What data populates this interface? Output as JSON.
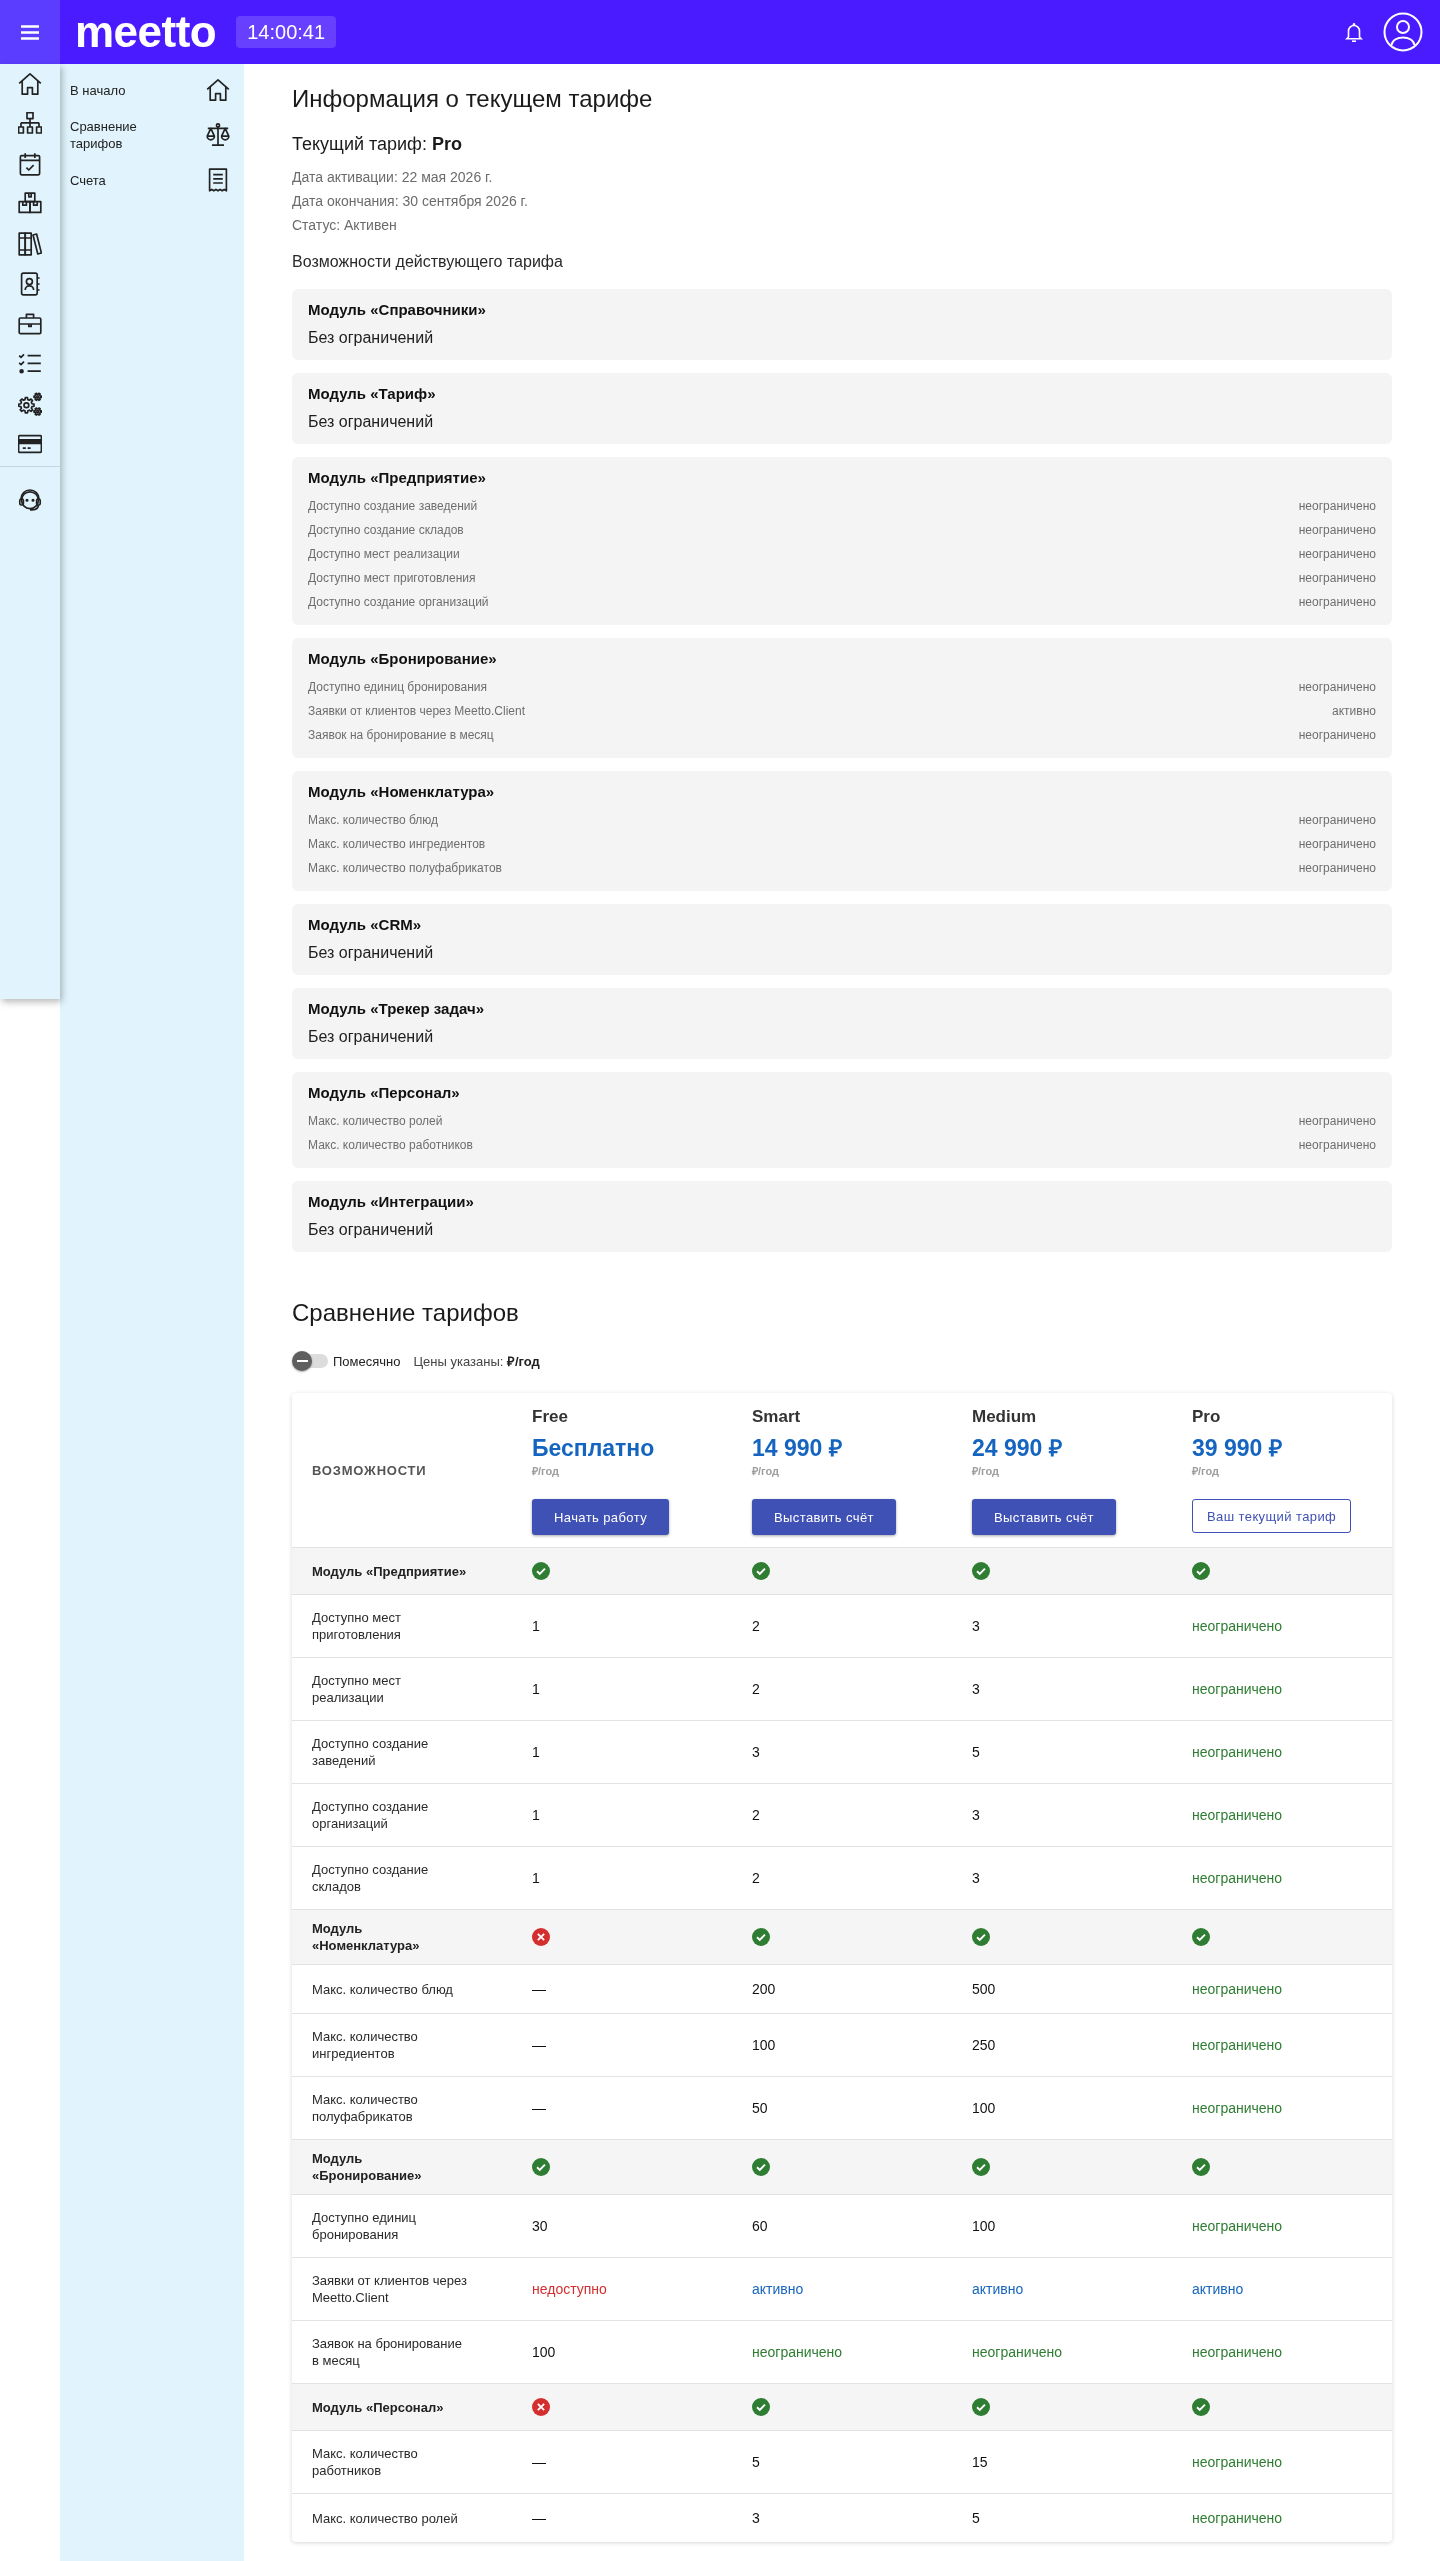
{
  "header": {
    "logo": "meetto",
    "clock": "14:00:41"
  },
  "sidebar": {
    "items": [
      "В начало",
      "Сравнение тарифов",
      "Счета"
    ]
  },
  "tariff_info": {
    "title": "Информация о текущем тарифе",
    "current": "Текущий тариф: **Pro**",
    "details": [
      "Дата активации: 22 мая 2026 г.",
      "Дата окончания: 30 сентября 2026 г.",
      "Статус: Активен"
    ],
    "features_title": "Возможности действующего тарифа",
    "modules": [
      {
        "kind": "summary",
        "title": "Модуль «Справочники»",
        "summary": "Без ограничений"
      },
      {
        "kind": "summary",
        "title": "Модуль «Тариф»",
        "summary": "Без ограничений"
      },
      {
        "kind": "limits",
        "title": "Модуль «Предприятие»",
        "limits": [
          {
            "label": "Доступно создание заведений",
            "value": "неограничено"
          },
          {
            "label": "Доступно создание складов",
            "value": "неограничено"
          },
          {
            "label": "Доступно мест реализации",
            "value": "неограничено"
          },
          {
            "label": "Доступно мест приготовления",
            "value": "неограничено"
          },
          {
            "label": "Доступно создание организаций",
            "value": "неограничено"
          }
        ]
      },
      {
        "kind": "limits",
        "title": "Модуль «Бронирование»",
        "limits": [
          {
            "label": "Доступно единиц бронирования",
            "value": "неограничено"
          },
          {
            "label": "Заявки от клиентов через Meetto.Client",
            "value": "активно"
          },
          {
            "label": "Заявок на бронирование в месяц",
            "value": "неограничено"
          }
        ]
      },
      {
        "kind": "limits",
        "title": "Модуль «Номенклатура»",
        "limits": [
          {
            "label": "Макс. количество блюд",
            "value": "неограничено"
          },
          {
            "label": "Макс. количество ингредиентов",
            "value": "неограничено"
          },
          {
            "label": "Макс. количество полуфабрикатов",
            "value": "неограничено"
          }
        ]
      },
      {
        "kind": "summary",
        "title": "Модуль «CRM»",
        "summary": "Без ограничений"
      },
      {
        "kind": "summary",
        "title": "Модуль «Трекер задач»",
        "summary": "Без ограничений"
      },
      {
        "kind": "limits",
        "title": "Модуль «Персонал»",
        "limits": [
          {
            "label": "Макс. количество ролей",
            "value": "неограничено"
          },
          {
            "label": "Макс. количество работников",
            "value": "неограничено"
          }
        ]
      },
      {
        "kind": "summary",
        "title": "Модуль «Интеграции»",
        "summary": "Без ограничений"
      }
    ]
  },
  "comparison": {
    "title": "Сравнение тарифов",
    "billing_toggle": {
      "label": "Помесячно",
      "on": false
    },
    "price_note": "Цены указаны: **₽/год**",
    "table": {
      "features_heading": "ВОЗМОЖНОСТИ",
      "plans": [
        {
          "name": "Free",
          "price": "Бесплатно",
          "period": "₽/год",
          "button": "Начать работу",
          "current": false
        },
        {
          "name": "Smart",
          "price": "14 990 ₽",
          "period": "₽/год",
          "button": "Выставить счёт",
          "current": false
        },
        {
          "name": "Medium",
          "price": "24 990 ₽",
          "period": "₽/год",
          "button": "Выставить счёт",
          "current": false
        },
        {
          "name": "Pro",
          "price": "39 990 ₽",
          "period": "₽/год",
          "button": "Ваш текущий тариф",
          "current": true
        }
      ],
      "rows": [
        {
          "kind": "module",
          "label": "Модуль «Предприятие»",
          "cells": [
            {
              "included": true
            },
            {
              "included": true
            },
            {
              "included": true
            },
            {
              "included": true
            }
          ]
        },
        {
          "kind": "feature",
          "label": "Доступно мест приготовления",
          "cells": [
            {
              "kind": "plain",
              "text": "1"
            },
            {
              "kind": "plain",
              "text": "2"
            },
            {
              "kind": "plain",
              "text": "3"
            },
            {
              "kind": "unlimited",
              "text": "неограничено"
            }
          ]
        },
        {
          "kind": "feature",
          "label": "Доступно мест реализации",
          "cells": [
            {
              "kind": "plain",
              "text": "1"
            },
            {
              "kind": "plain",
              "text": "2"
            },
            {
              "kind": "plain",
              "text": "3"
            },
            {
              "kind": "unlimited",
              "text": "неограничено"
            }
          ]
        },
        {
          "kind": "feature",
          "label": "Доступно создание заведений",
          "cells": [
            {
              "kind": "plain",
              "text": "1"
            },
            {
              "kind": "plain",
              "text": "3"
            },
            {
              "kind": "plain",
              "text": "5"
            },
            {
              "kind": "unlimited",
              "text": "неограничено"
            }
          ]
        },
        {
          "kind": "feature",
          "label": "Доступно создание организаций",
          "cells": [
            {
              "kind": "plain",
              "text": "1"
            },
            {
              "kind": "plain",
              "text": "2"
            },
            {
              "kind": "plain",
              "text": "3"
            },
            {
              "kind": "unlimited",
              "text": "неограничено"
            }
          ]
        },
        {
          "kind": "feature",
          "label": "Доступно создание складов",
          "cells": [
            {
              "kind": "plain",
              "text": "1"
            },
            {
              "kind": "plain",
              "text": "2"
            },
            {
              "kind": "plain",
              "text": "3"
            },
            {
              "kind": "unlimited",
              "text": "неограничено"
            }
          ]
        },
        {
          "kind": "module",
          "label": "Модуль «Номенклатура»",
          "cells": [
            {
              "included": false
            },
            {
              "included": true
            },
            {
              "included": true
            },
            {
              "included": true
            }
          ]
        },
        {
          "kind": "feature",
          "label": "Макс. количество блюд",
          "cells": [
            {
              "kind": "plain",
              "text": "—"
            },
            {
              "kind": "plain",
              "text": "200"
            },
            {
              "kind": "plain",
              "text": "500"
            },
            {
              "kind": "unlimited",
              "text": "неограничено"
            }
          ]
        },
        {
          "kind": "feature",
          "label": "Макс. количество ингредиентов",
          "cells": [
            {
              "kind": "plain",
              "text": "—"
            },
            {
              "kind": "plain",
              "text": "100"
            },
            {
              "kind": "plain",
              "text": "250"
            },
            {
              "kind": "unlimited",
              "text": "неограничено"
            }
          ]
        },
        {
          "kind": "feature",
          "label": "Макс. количество полуфабрикатов",
          "cells": [
            {
              "kind": "plain",
              "text": "—"
            },
            {
              "kind": "plain",
              "text": "50"
            },
            {
              "kind": "plain",
              "text": "100"
            },
            {
              "kind": "unlimited",
              "text": "неограничено"
            }
          ]
        },
        {
          "kind": "module",
          "label": "Модуль «Бронирование»",
          "cells": [
            {
              "included": true
            },
            {
              "included": true
            },
            {
              "included": true
            },
            {
              "included": true
            }
          ]
        },
        {
          "kind": "feature",
          "label": "Доступно единиц бронирования",
          "cells": [
            {
              "kind": "plain",
              "text": "30"
            },
            {
              "kind": "plain",
              "text": "60"
            },
            {
              "kind": "plain",
              "text": "100"
            },
            {
              "kind": "unlimited",
              "text": "неограничено"
            }
          ]
        },
        {
          "kind": "feature",
          "label": "Заявки от клиентов через Meetto.Client",
          "cells": [
            {
              "kind": "unavailable",
              "text": "недоступно"
            },
            {
              "kind": "active",
              "text": "активно"
            },
            {
              "kind": "active",
              "text": "активно"
            },
            {
              "kind": "active",
              "text": "активно"
            }
          ]
        },
        {
          "kind": "feature",
          "label": "Заявок на бронирование в месяц",
          "cells": [
            {
              "kind": "plain",
              "text": "100"
            },
            {
              "kind": "unlimited",
              "text": "неограничено"
            },
            {
              "kind": "unlimited",
              "text": "неограничено"
            },
            {
              "kind": "unlimited",
              "text": "неограничено"
            }
          ]
        },
        {
          "kind": "module",
          "label": "Модуль «Персонал»",
          "cells": [
            {
              "included": false
            },
            {
              "included": true
            },
            {
              "included": true
            },
            {
              "included": true
            }
          ]
        },
        {
          "kind": "feature",
          "label": "Макс. количество работников",
          "cells": [
            {
              "kind": "plain",
              "text": "—"
            },
            {
              "kind": "plain",
              "text": "5"
            },
            {
              "kind": "plain",
              "text": "15"
            },
            {
              "kind": "unlimited",
              "text": "неограничено"
            }
          ]
        },
        {
          "kind": "feature",
          "label": "Макс. количество ролей",
          "cells": [
            {
              "kind": "plain",
              "text": "—"
            },
            {
              "kind": "plain",
              "text": "3"
            },
            {
              "kind": "plain",
              "text": "5"
            },
            {
              "kind": "unlimited",
              "text": "неограничено"
            }
          ]
        }
      ]
    }
  }
}
